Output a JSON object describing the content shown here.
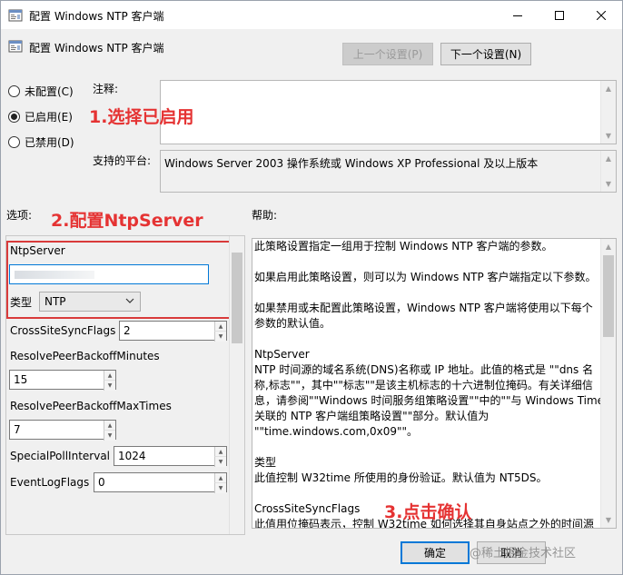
{
  "window": {
    "title": "配置 Windows NTP 客户端",
    "header_title": "配置 Windows NTP 客户端"
  },
  "nav": {
    "prev_label": "上一个设置(P)",
    "next_label": "下一个设置(N)"
  },
  "state": {
    "options": [
      {
        "label": "未配置(C)",
        "selected": false
      },
      {
        "label": "已启用(E)",
        "selected": true
      },
      {
        "label": "已禁用(D)",
        "selected": false
      }
    ]
  },
  "comment_label": "注释:",
  "platform_label": "支持的平台:",
  "platform_value": "Windows Server 2003 操作系统或 Windows XP Professional 及以上版本",
  "options_label": "选项:",
  "help_label": "帮助:",
  "annotations": {
    "step1": "1.选择已启用",
    "step2": "2.配置NtpServer",
    "step3": "3.点击确认"
  },
  "options_panel": {
    "ntpserver_label": "NtpServer",
    "ntpserver_value": "",
    "type_label": "类型",
    "type_value": "NTP",
    "crosssite_label": "CrossSiteSyncFlags",
    "crosssite_value": "2",
    "backoff_min_label": "ResolvePeerBackoffMinutes",
    "backoff_min_value": "15",
    "backoff_max_label": "ResolvePeerBackoffMaxTimes",
    "backoff_max_value": "7",
    "special_label": "SpecialPollInterval",
    "special_value": "1024",
    "eventlog_label": "EventLogFlags",
    "eventlog_value": "0"
  },
  "help": {
    "lines": [
      "此策略设置指定一组用于控制 Windows NTP 客户端的参数。",
      "",
      "如果启用此策略设置，则可以为 Windows NTP 客户端指定以下参数。",
      "",
      "如果禁用或未配置此策略设置，Windows NTP 客户端将使用以下每个",
      "参数的默认值。",
      "",
      "NtpServer",
      "NTP 时间源的域名系统(DNS)名称或 IP 地址。此值的格式是 \"\"dns 名",
      "称,标志\"\"，其中\"\"标志\"\"是该主机标志的十六进制位掩码。有关详细信",
      "息，请参阅\"\"Windows 时间服务组策略设置\"\"中的\"\"与 Windows Time",
      "关联的 NTP 客户端组策略设置\"\"部分。默认值为",
      "\"\"time.windows.com,0x09\"\"。",
      "",
      "类型",
      "此值控制 W32time 所使用的身份验证。默认值为 NT5DS。",
      "",
      "CrossSiteSyncFlags",
      "此值用位掩码表示，控制 W32time 如何选择其自身站点之外的时间源"
    ]
  },
  "footer": {
    "ok_label": "确定",
    "cancel_label": "取消"
  },
  "watermark": "@稀土掘金技术社区",
  "colors": {
    "accent": "#0078d7",
    "annotation": "#e53333"
  }
}
